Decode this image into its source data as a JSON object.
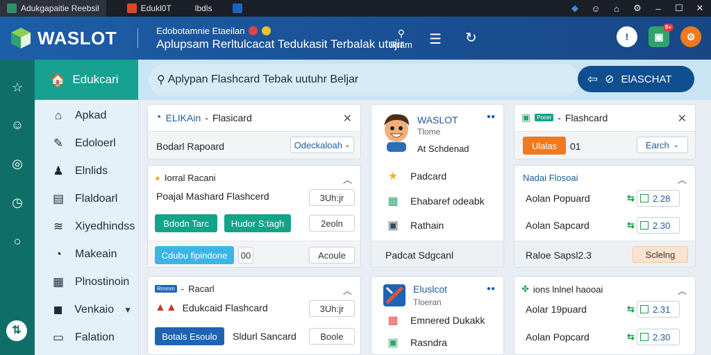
{
  "tabs": [
    {
      "label": "Adukgapaitie Reebsil",
      "color": "#2f8f6a"
    },
    {
      "label": "Edukl0T",
      "color": "#d64a2b"
    },
    {
      "label": "lbdls",
      "color": "#3d7bd0"
    },
    {
      "label": "",
      "color": "#1f62c0"
    }
  ],
  "window_controls": [
    "shield-icon",
    "smiley-icon",
    "home-icon",
    "gear-icon",
    "minimize-icon",
    "maximize-icon",
    "close-icon"
  ],
  "header": {
    "logo": "WASLOT",
    "subtitle": "Edobotamnie Etaeilan",
    "title": "Aplupsam Rerltulcacat Tedukasit Terbalak utujir",
    "tool1_label": "Rram",
    "avatar_badge": "9+"
  },
  "rail": [
    "star-icon",
    "smile-icon",
    "compass-icon",
    "clock-icon",
    "circle-icon"
  ],
  "sidebar": {
    "title": "Edukcari",
    "items": [
      {
        "label": "Apkad",
        "icon": "home-icon"
      },
      {
        "label": "Edoloerl",
        "icon": "edit-icon"
      },
      {
        "label": "Elnlids",
        "icon": "user-icon"
      },
      {
        "label": "Flaldoarl",
        "icon": "list-icon"
      },
      {
        "label": "Xiyedhindss",
        "icon": "wifi-icon"
      },
      {
        "label": "Makeain",
        "icon": "timer-icon"
      },
      {
        "label": "Plnostinoin",
        "icon": "grid-icon"
      },
      {
        "label": "Venkaio",
        "icon": "bag-icon",
        "caret": "▼"
      },
      {
        "label": "Falation",
        "icon": "doc-icon"
      }
    ]
  },
  "search": {
    "placeholder": "Aplypan Flashcard Tebak uutuhr Beljar"
  },
  "flash_button": {
    "label": "ElASCHAT"
  },
  "card1": {
    "title_a": "ELIKAin",
    "title_b": "Flasicard",
    "label": "Bodarl Rapoard",
    "select": "Odeckaloah"
  },
  "card2": {
    "header": "Iorral Racani",
    "row_label": "Poajal Mashard Flashcerd",
    "row_chip": "3Uh:jr",
    "btn1": "Bdodn Tarc",
    "btn2": "Hudor S:tagh",
    "chip2": "2eoln",
    "btn3": "Cdubu fipindone",
    "chip3": "00",
    "chip4": "Acoule"
  },
  "card3": {
    "header_tag": "Rmmm",
    "header": "Racarl",
    "row_label": "Edukcaid Flashcard",
    "row_chip": "3Uh:jr",
    "btn": "Botals Esoulo",
    "label": "Sldurl Sancard",
    "chip": "Boole"
  },
  "profile": {
    "name": "WASLOT",
    "subtitle": "Tlome",
    "line": "At Schdenad",
    "items": [
      "Padcard",
      "Ehabaref odeabk",
      "Rathain"
    ],
    "footer": "Padcat Sdgcanl"
  },
  "middle2": {
    "title": "Eluslcot",
    "subtitle": "Tloeran",
    "items": [
      "Emnered Dukakk",
      "Rasndra"
    ]
  },
  "card5": {
    "tag": "Pocer",
    "title": "Flashcard",
    "tag2": "Ulalas",
    "val": "01",
    "select": "Earch"
  },
  "card6": {
    "header": "Nadai Flosoai",
    "rows": [
      {
        "label": "Aolan Popuard",
        "time": "2.28"
      },
      {
        "label": "Aolan Sapcard",
        "time": "2.30"
      }
    ],
    "footer": "Raloe Sapsl2.3",
    "footer_btn": "Sclelng"
  },
  "card7": {
    "header": "ions lnlnel haooai",
    "rows": [
      {
        "label": "Aolar 19puard",
        "time": "2.31"
      },
      {
        "label": "Aolan Popcard",
        "time": "2.30"
      }
    ]
  },
  "colors": {
    "header_blue": "#1d5ea8",
    "rail_teal": "#0f6f68",
    "sidebar_head": "#16a090",
    "btn_teal": "#13a389",
    "btn_blue": "#1f63b5",
    "btn_cyan": "#3bb4e6",
    "accent_orange": "#f07a1f"
  }
}
